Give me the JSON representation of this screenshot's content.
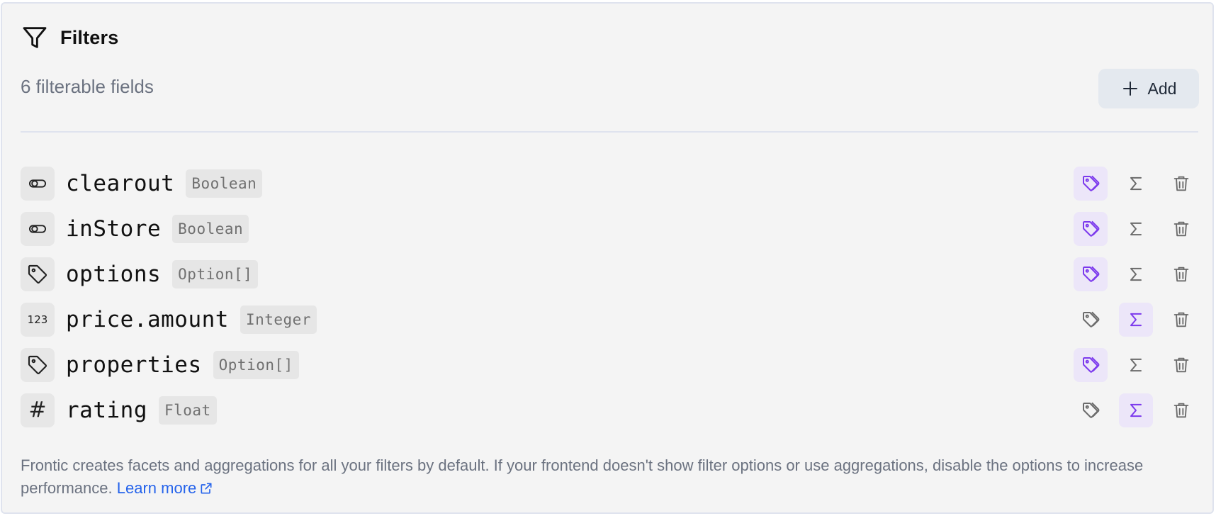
{
  "header": {
    "title": "Filters",
    "icon": "filter-funnel-icon"
  },
  "subtitle": "6 filterable fields",
  "add_button": {
    "label": "Add",
    "icon": "plus-icon"
  },
  "fields": [
    {
      "name": "clearout",
      "type": "Boolean",
      "type_icon": "toggle-icon",
      "facet_on": true,
      "aggregation_on": false
    },
    {
      "name": "inStore",
      "type": "Boolean",
      "type_icon": "toggle-icon",
      "facet_on": true,
      "aggregation_on": false
    },
    {
      "name": "options",
      "type": "Option[]",
      "type_icon": "tag-icon",
      "facet_on": true,
      "aggregation_on": false
    },
    {
      "name": "price.amount",
      "type": "Integer",
      "type_icon": "integer-icon",
      "type_icon_text": "123",
      "facet_on": false,
      "aggregation_on": true
    },
    {
      "name": "properties",
      "type": "Option[]",
      "type_icon": "tag-icon",
      "facet_on": true,
      "aggregation_on": false
    },
    {
      "name": "rating",
      "type": "Float",
      "type_icon": "hash-icon",
      "type_icon_text": "#",
      "facet_on": false,
      "aggregation_on": true
    }
  ],
  "footer": {
    "text": "Frontic creates facets and aggregations for all your filters by default. If your frontend doesn't show filter options or use aggregations, disable the options to increase performance.",
    "link_label": "Learn more",
    "link_icon": "external-link-icon"
  },
  "colors": {
    "accent": "#7c3aed",
    "accent_bg": "#ece6f9",
    "link": "#2563eb",
    "muted_text": "#6b7280",
    "icon_gray": "#6b6b6b"
  }
}
